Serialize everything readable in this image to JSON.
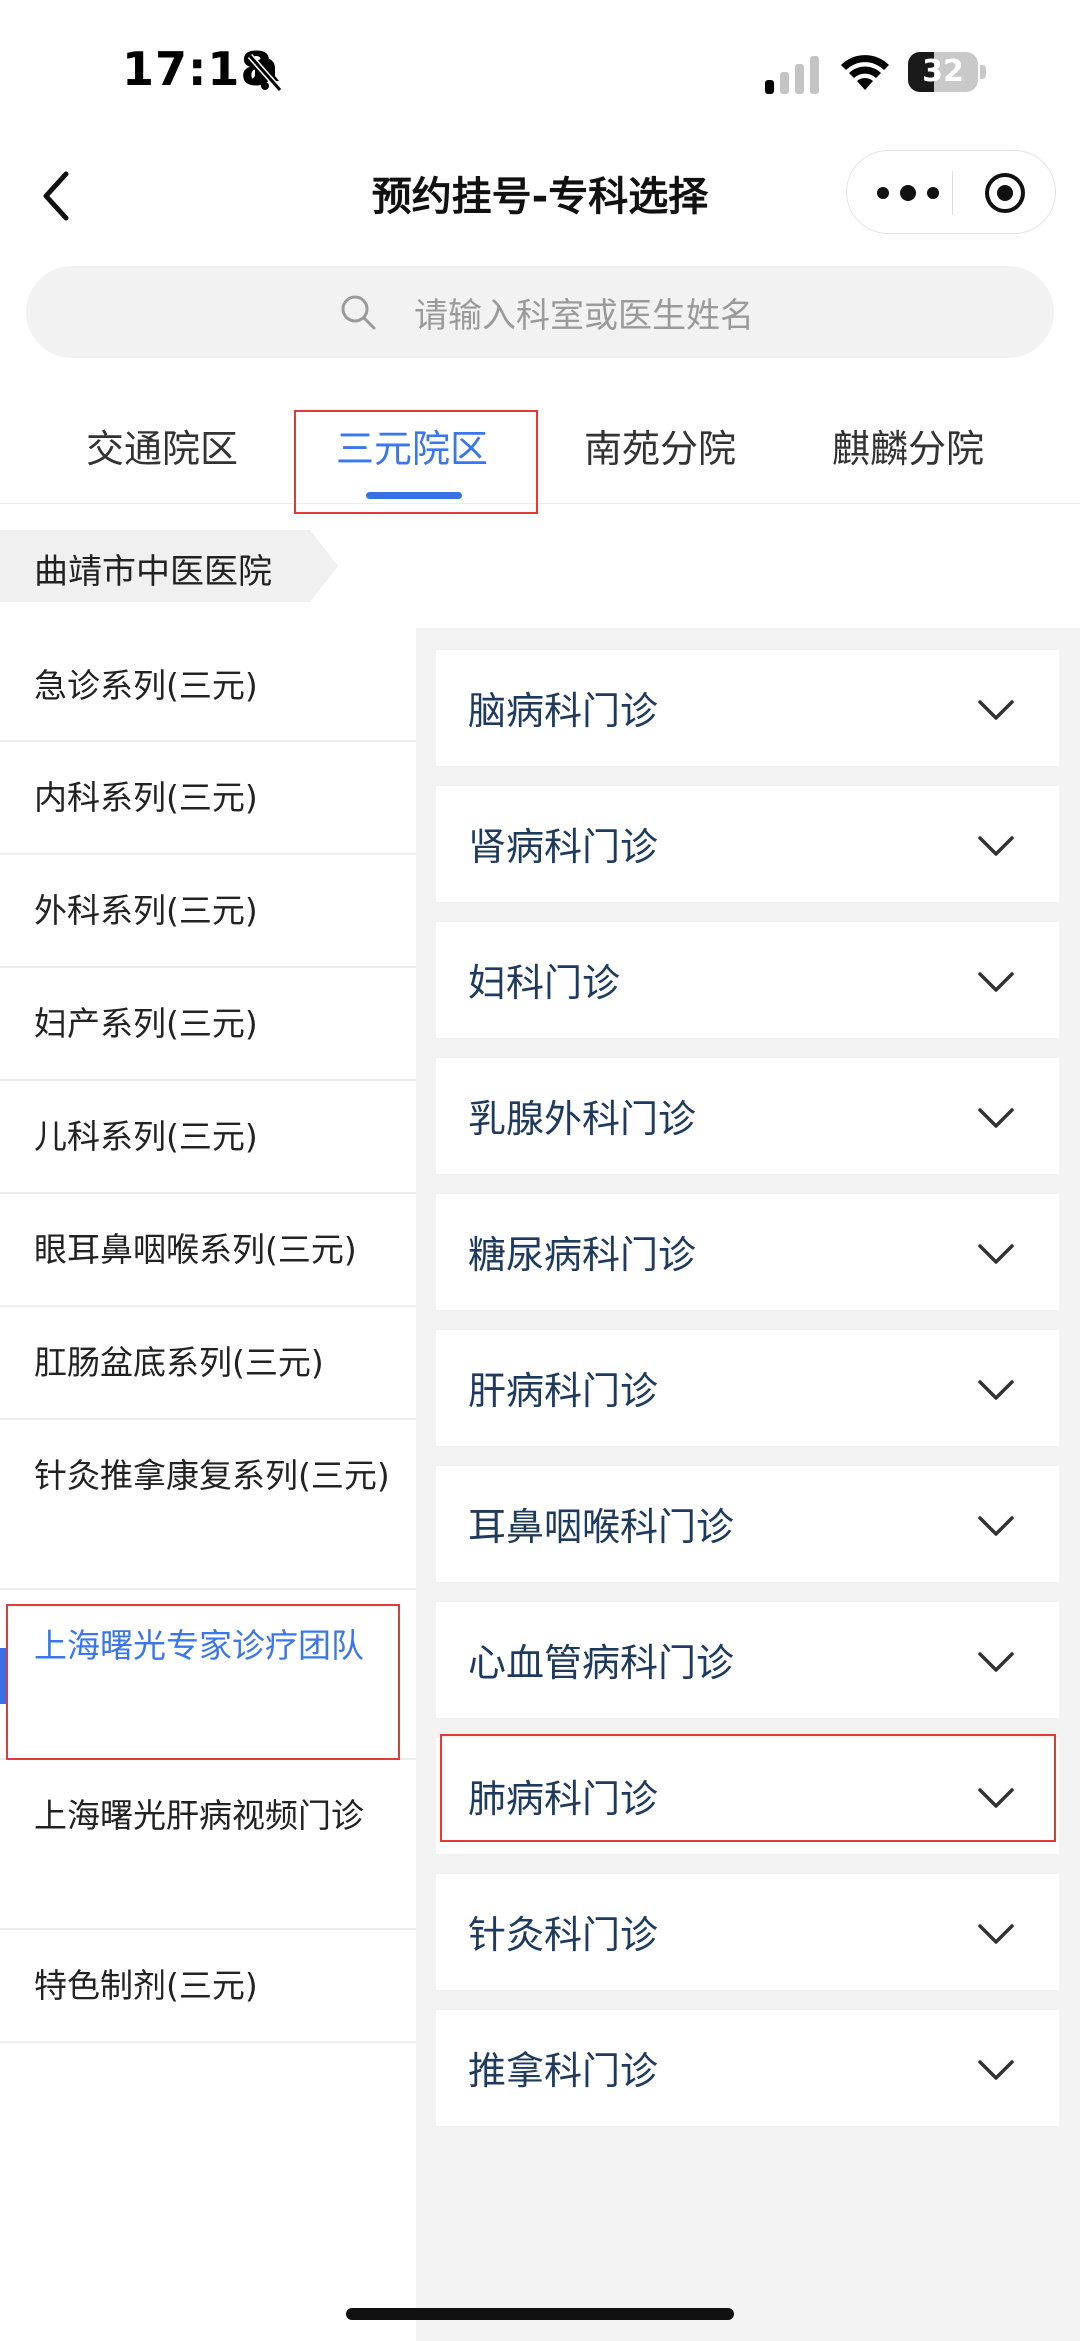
{
  "status": {
    "time": "17:18",
    "battery": "32"
  },
  "nav": {
    "title": "预约挂号-专科选择"
  },
  "search": {
    "placeholder": "请输入科室或医生姓名"
  },
  "tabs": [
    {
      "label": "交通院区"
    },
    {
      "label": "三元院区",
      "active": true
    },
    {
      "label": "南苑分院"
    },
    {
      "label": "麒麟分院"
    }
  ],
  "breadcrumb": {
    "label": "曲靖市中医医院"
  },
  "categories": [
    {
      "label": "急诊系列(三元)"
    },
    {
      "label": "内科系列(三元)"
    },
    {
      "label": "外科系列(三元)"
    },
    {
      "label": "妇产系列(三元)"
    },
    {
      "label": "儿科系列(三元)"
    },
    {
      "label": "眼耳鼻咽喉系列(三元)"
    },
    {
      "label": "肛肠盆底系列(三元)"
    },
    {
      "label": "针灸推拿康复系列(三元)"
    },
    {
      "label": "上海曙光专家诊疗团队",
      "active": true
    },
    {
      "label": "上海曙光肝病视频门诊"
    },
    {
      "label": "特色制剂(三元)"
    }
  ],
  "departments": [
    {
      "label": "脑病科门诊"
    },
    {
      "label": "肾病科门诊"
    },
    {
      "label": "妇科门诊"
    },
    {
      "label": "乳腺外科门诊"
    },
    {
      "label": "糖尿病科门诊"
    },
    {
      "label": "肝病科门诊"
    },
    {
      "label": "耳鼻咽喉科门诊"
    },
    {
      "label": "心血管病科门诊"
    },
    {
      "label": "肺病科门诊",
      "highlighted": true
    },
    {
      "label": "针灸科门诊"
    },
    {
      "label": "推拿科门诊"
    }
  ],
  "colors": {
    "accent": "#3a77ee",
    "highlight_box": "#e53935",
    "dept_text": "#1f3a5f"
  }
}
